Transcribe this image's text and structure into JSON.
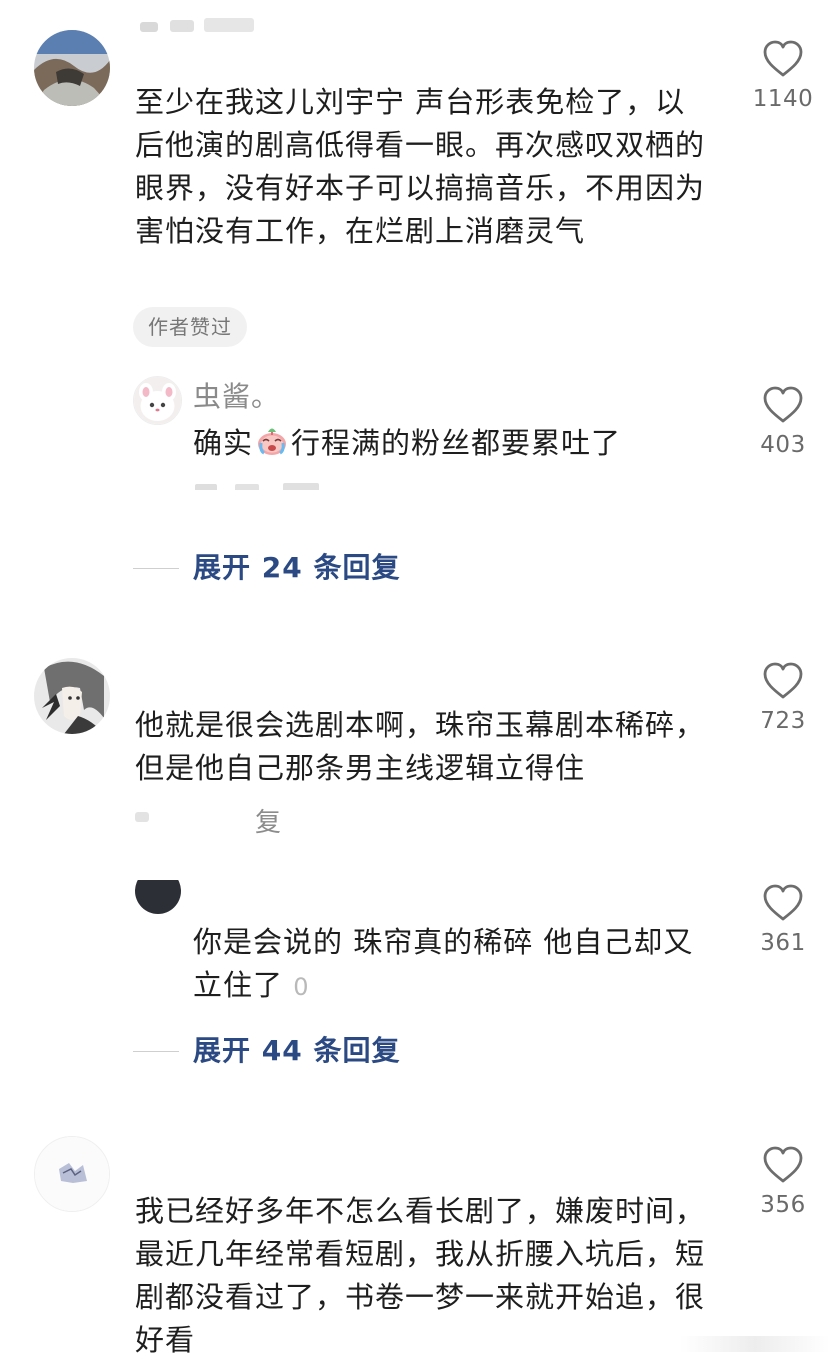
{
  "comments": [
    {
      "text": "至少在我这儿刘宇宁 声台形表免检了，以后他演的剧高低得看一眼。再次感叹双栖的眼界，没有好本子可以搞搞音乐，不用因为害怕没有工作，在烂剧上消磨灵气",
      "likes": "1140",
      "badge": "作者赞过",
      "reply": {
        "name": "虫酱。",
        "text_before_emoji": "确实",
        "emoji": "crying-face-emoji",
        "text_after_emoji": "行程满的粉丝都要累吐了",
        "likes": "403"
      },
      "expand": "展开 24 条回复"
    },
    {
      "text": "他就是很会选剧本啊，珠帘玉幕剧本稀碎，但是他自己那条男主线逻辑立得住",
      "likes": "723",
      "meta_tail": "复",
      "reply": {
        "text": "你是会说的 珠帘真的稀碎 他自己却又立住了",
        "meta_tail": "0",
        "likes": "361"
      },
      "expand": "展开 44 条回复"
    },
    {
      "text": "我已经好多年不怎么看长剧了，嫌废时间，最近几年经常看短剧，我从折腰入坑后，短剧都没看过了，书卷一梦一来就开始追，很好看",
      "likes": "356"
    }
  ],
  "colors": {
    "text": "#1e1e1e",
    "muted": "#8a8a8a",
    "link": "#2b4a83",
    "badge_bg": "#f1f1f1"
  },
  "icons": {
    "like": "heart-outline-icon"
  }
}
